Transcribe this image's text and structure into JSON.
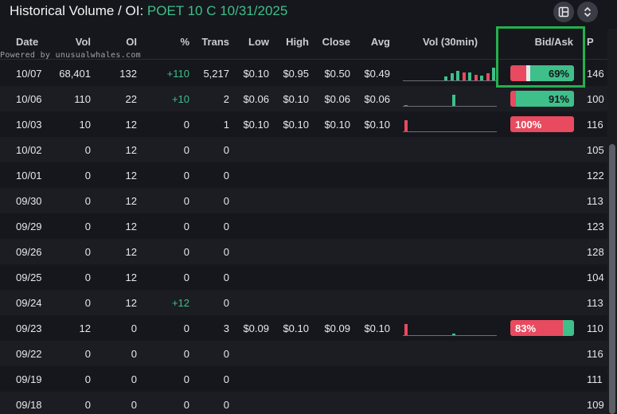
{
  "header": {
    "title_prefix": "Historical Volume / OI: ",
    "contract": "POET 10 C 10/31/2025",
    "icon_layout": "layout-icon",
    "icon_expand": "expand-collapse-icon"
  },
  "powered_by": "Powered by unusualwhales.com",
  "columns": {
    "date": "Date",
    "vol": "Vol",
    "oi": "OI",
    "pct": "%",
    "trans": "Trans",
    "low": "Low",
    "high": "High",
    "close": "Close",
    "avg": "Avg",
    "vol30": "Vol (30min)",
    "bidask": "Bid/Ask",
    "extra": "P"
  },
  "rows": [
    {
      "date": "10/07",
      "vol": "68,401",
      "oi": "132",
      "pct": "+110",
      "trans": "5,217",
      "low": "$0.10",
      "high": "$0.95",
      "close": "$0.50",
      "avg": "$0.49",
      "bidask": "69%",
      "extra": "146"
    },
    {
      "date": "10/06",
      "vol": "110",
      "oi": "22",
      "pct": "+10",
      "trans": "2",
      "low": "$0.06",
      "high": "$0.10",
      "close": "$0.06",
      "avg": "$0.06",
      "bidask": "91%",
      "extra": "100"
    },
    {
      "date": "10/03",
      "vol": "10",
      "oi": "12",
      "pct": "0",
      "trans": "1",
      "low": "$0.10",
      "high": "$0.10",
      "close": "$0.10",
      "avg": "$0.10",
      "bidask": "100%",
      "extra": "116"
    },
    {
      "date": "10/02",
      "vol": "0",
      "oi": "12",
      "pct": "0",
      "trans": "0",
      "extra": "105"
    },
    {
      "date": "10/01",
      "vol": "0",
      "oi": "12",
      "pct": "0",
      "trans": "0",
      "extra": "122"
    },
    {
      "date": "09/30",
      "vol": "0",
      "oi": "12",
      "pct": "0",
      "trans": "0",
      "extra": "113"
    },
    {
      "date": "09/29",
      "vol": "0",
      "oi": "12",
      "pct": "0",
      "trans": "0",
      "extra": "123"
    },
    {
      "date": "09/26",
      "vol": "0",
      "oi": "12",
      "pct": "0",
      "trans": "0",
      "extra": "128"
    },
    {
      "date": "09/25",
      "vol": "0",
      "oi": "12",
      "pct": "0",
      "trans": "0",
      "extra": "104"
    },
    {
      "date": "09/24",
      "vol": "0",
      "oi": "12",
      "pct": "+12",
      "trans": "0",
      "extra": "113"
    },
    {
      "date": "09/23",
      "vol": "12",
      "oi": "0",
      "pct": "0",
      "trans": "3",
      "low": "$0.09",
      "high": "$0.10",
      "close": "$0.09",
      "avg": "$0.10",
      "bidask": "83%",
      "extra": "110"
    },
    {
      "date": "09/22",
      "vol": "0",
      "oi": "0",
      "pct": "0",
      "trans": "0",
      "extra": "116"
    },
    {
      "date": "09/19",
      "vol": "0",
      "oi": "0",
      "pct": "0",
      "trans": "0",
      "extra": "111"
    },
    {
      "date": "09/18",
      "vol": "0",
      "oi": "0",
      "pct": "0",
      "trans": "0",
      "extra": "109"
    }
  ],
  "bid_ask_split": [
    {
      "bid": 0.25,
      "mid": 0.06,
      "ask": 0.69
    },
    {
      "bid": 0.09,
      "mid": 0.0,
      "ask": 0.91
    },
    {
      "bid": 1.0,
      "mid": 0.0,
      "ask": 0.0
    },
    null,
    null,
    null,
    null,
    null,
    null,
    null,
    {
      "bid": 0.83,
      "mid": 0.0,
      "ask": 0.17
    },
    null,
    null,
    null
  ],
  "vol30_bars": [
    [
      {
        "c": "green",
        "h": 0.25
      },
      {
        "c": "green",
        "h": 0.45
      },
      {
        "c": "green",
        "h": 0.6
      },
      {
        "c": "red",
        "h": 0.5
      },
      {
        "c": "green",
        "h": 0.5
      },
      {
        "c": "red",
        "h": 0.35
      },
      {
        "c": "green",
        "h": 0.3
      },
      {
        "c": "red",
        "h": 0.45
      },
      {
        "c": "green",
        "h": 0.8
      }
    ],
    [
      {
        "c": "red",
        "h": 0.05
      },
      {
        "c": "green",
        "h": 0.7
      }
    ],
    [
      {
        "c": "red",
        "h": 0.7
      }
    ],
    null,
    null,
    null,
    null,
    null,
    null,
    null,
    [
      {
        "c": "red",
        "h": 0.7
      },
      {
        "c": "green",
        "h": 0.1
      }
    ],
    null,
    null,
    null
  ],
  "colors": {
    "green": "#3fbf8a",
    "red": "#e84a5f",
    "highlight": "#23b14d"
  }
}
